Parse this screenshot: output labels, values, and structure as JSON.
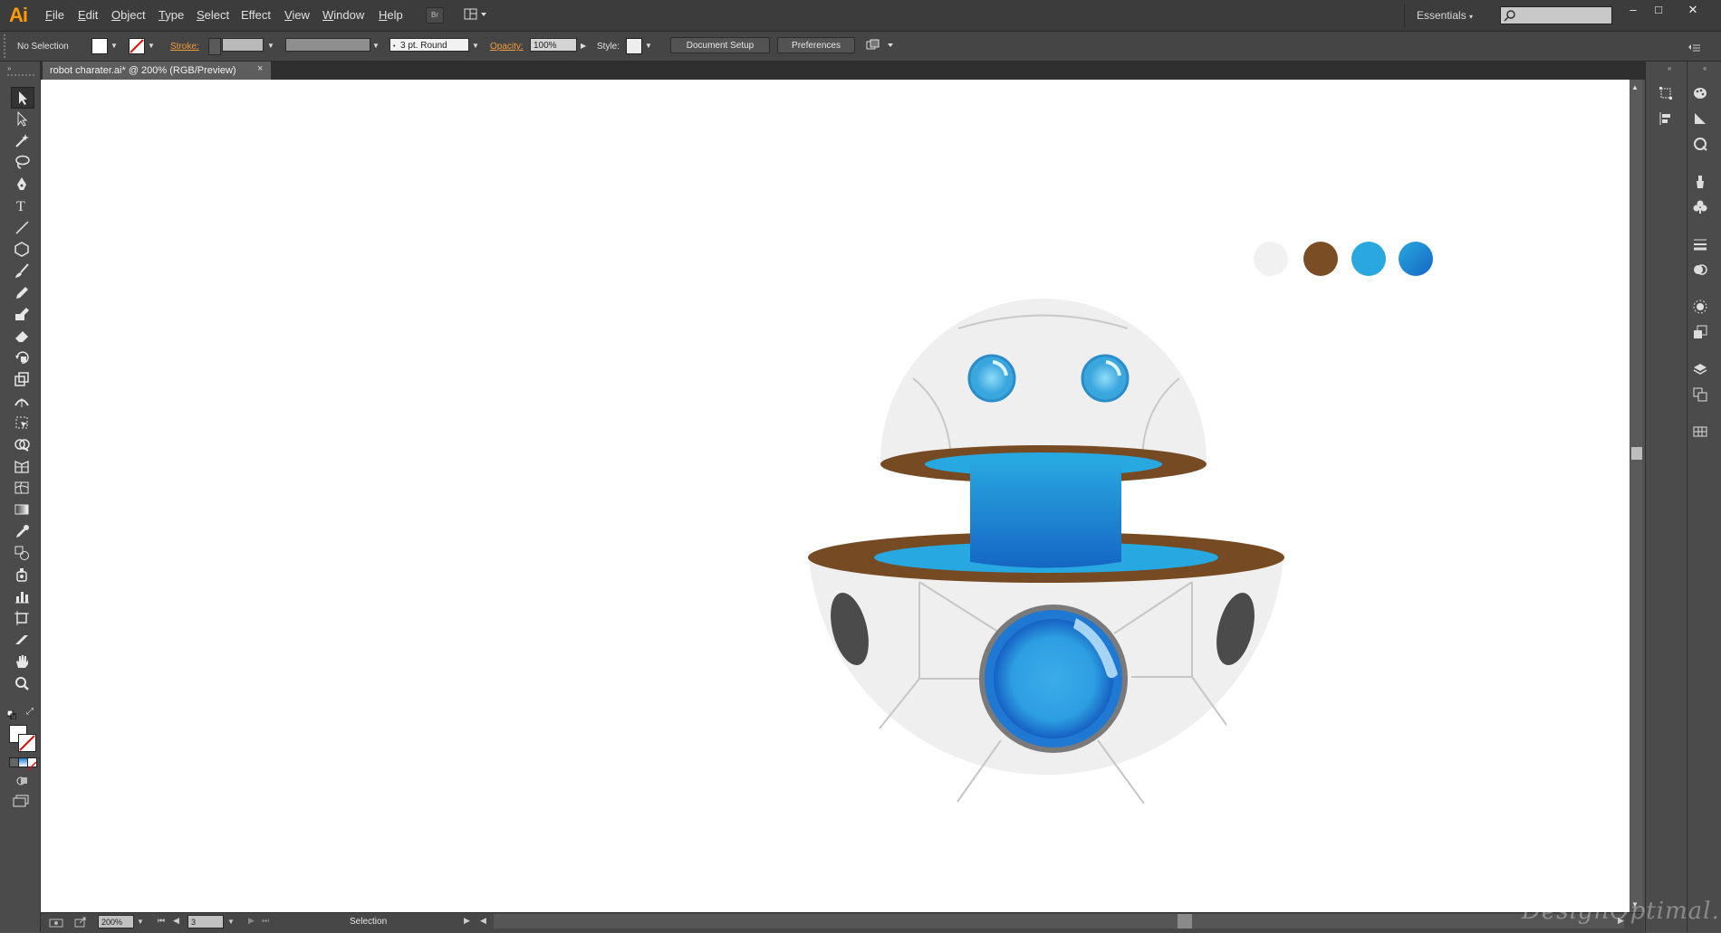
{
  "app": {
    "logo": "Ai"
  },
  "menu": {
    "items": [
      {
        "label": "File",
        "underline": "F",
        "rest": "ile"
      },
      {
        "label": "Edit",
        "underline": "E",
        "rest": "dit"
      },
      {
        "label": "Object",
        "underline": "O",
        "rest": "bject"
      },
      {
        "label": "Type",
        "underline": "T",
        "rest": "ype"
      },
      {
        "label": "Select",
        "underline": "S",
        "rest": "elect"
      },
      {
        "label": "Effect",
        "underline": "C",
        "rest": ""
      },
      {
        "label": "View",
        "underline": "V",
        "rest": "iew"
      },
      {
        "label": "Window",
        "underline": "W",
        "rest": "indow"
      },
      {
        "label": "Help",
        "underline": "H",
        "rest": "elp"
      }
    ],
    "bridge_label": "Br",
    "workspace": "Essentials",
    "search_placeholder": "",
    "window_buttons": {
      "minimize": "–",
      "restore": "□",
      "close": "✕"
    }
  },
  "control": {
    "selection": "No Selection",
    "stroke_label": "Stroke:",
    "brush": "3 pt. Round",
    "opacity_label": "Opacity:",
    "opacity_value": "100%",
    "style_label": "Style:",
    "doc_setup": "Document Setup",
    "preferences": "Preferences"
  },
  "document": {
    "tab_title": "robot charater.ai* @ 200% (RGB/Preview)",
    "close": "×"
  },
  "status": {
    "zoom": "200%",
    "artboard": "3",
    "tool": "Selection"
  },
  "watermark": "DesignOptimal.com",
  "colors": {
    "accent": "#ff9a00",
    "swatches": [
      "#f1f1f1",
      "#7a4d24",
      "#29a8e0",
      "#1a7fd0"
    ],
    "robot_white": "#efefef",
    "robot_brown": "#764a22",
    "robot_blue": "#27a8e0",
    "robot_blue_dark": "#1566c3"
  },
  "tools": [
    "selection-tool",
    "direct-selection-tool",
    "magic-wand-tool",
    "lasso-tool",
    "pen-tool",
    "type-tool",
    "line-tool",
    "ellipse-tool",
    "paintbrush-tool",
    "pencil-tool",
    "blob-brush-tool",
    "eraser-tool",
    "rotate-tool",
    "scale-tool",
    "warp-tool",
    "free-transform-tool",
    "shape-builder-tool",
    "perspective-tool",
    "mesh-tool",
    "gradient-tool",
    "eyedropper-tool",
    "blend-tool",
    "symbol-sprayer-tool",
    "graph-tool",
    "artboard-tool",
    "slice-tool",
    "hand-tool",
    "zoom-tool"
  ]
}
